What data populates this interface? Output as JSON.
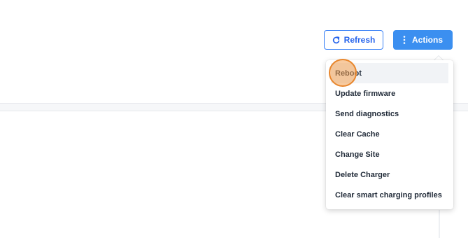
{
  "toolbar": {
    "refresh_label": "Refresh",
    "actions_label": "Actions"
  },
  "icons": {
    "refresh": "refresh-icon",
    "actions": "vertical-dots-icon"
  },
  "actions_menu": {
    "items": [
      {
        "label": "Reboot",
        "active": true
      },
      {
        "label": "Update firmware"
      },
      {
        "label": "Send diagnostics"
      },
      {
        "label": "Clear Cache"
      },
      {
        "label": "Change Site"
      },
      {
        "label": "Delete Charger"
      },
      {
        "label": "Clear smart charging profiles"
      }
    ]
  },
  "colors": {
    "primary": "#3b8ff0",
    "primary_text": "#2563eb",
    "menu_text": "#1f2937",
    "highlight": "#f1f3f6",
    "click_marker": "#e8862c"
  }
}
